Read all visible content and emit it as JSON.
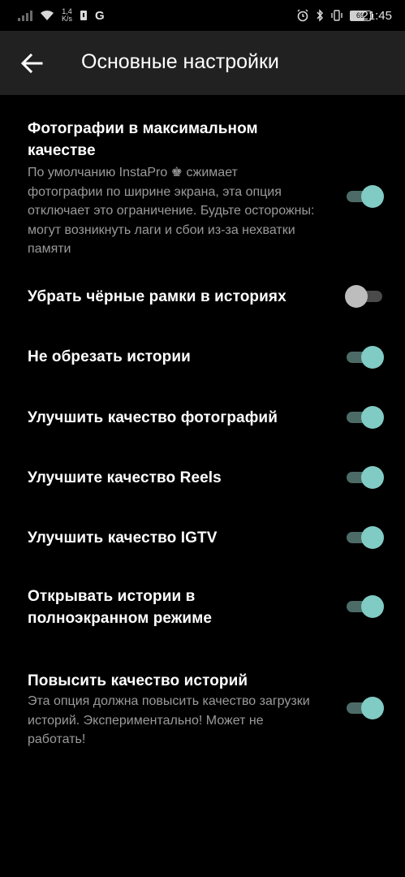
{
  "status_bar": {
    "speed_top": "1,4",
    "speed_bottom": "K/s",
    "carrier_letter": "G",
    "battery": "69",
    "time": "21:45"
  },
  "appbar": {
    "title": "Основные настройки",
    "back_icon": "arrow-left-icon"
  },
  "colors": {
    "switch_on_thumb": "#80cbc4",
    "switch_on_track": "#4c6b67",
    "switch_off_thumb": "#bdbdbd",
    "switch_off_track": "#4a4a4a",
    "appbar_bg": "#212121"
  },
  "settings": [
    {
      "title": "Фотографии в максимальном качестве",
      "subtitle": "По умолчанию InstaPro ♚ сжимает фотографии по ширине экрана, эта опция отключает это ограничение. Будьте осторожны: могут возникнуть лаги и сбои из-за нехватки памяти",
      "enabled": true
    },
    {
      "title": "Убрать чёрные рамки в историях",
      "subtitle": "",
      "enabled": false
    },
    {
      "title": "Не обрезать истории",
      "subtitle": "",
      "enabled": true
    },
    {
      "title": "Улучшить качество фотографий",
      "subtitle": "",
      "enabled": true
    },
    {
      "title": "Улучшите качество Reels",
      "subtitle": "",
      "enabled": true
    },
    {
      "title": "Улучшить качество IGTV",
      "subtitle": "",
      "enabled": true
    },
    {
      "title": "Открывать истории в полноэкранном режиме",
      "subtitle": "",
      "enabled": true
    },
    {
      "title": "Повысить качество историй",
      "subtitle": "Эта опция должна повысить качество загрузки историй. Экспериментально! Может не работать!",
      "enabled": true
    }
  ]
}
